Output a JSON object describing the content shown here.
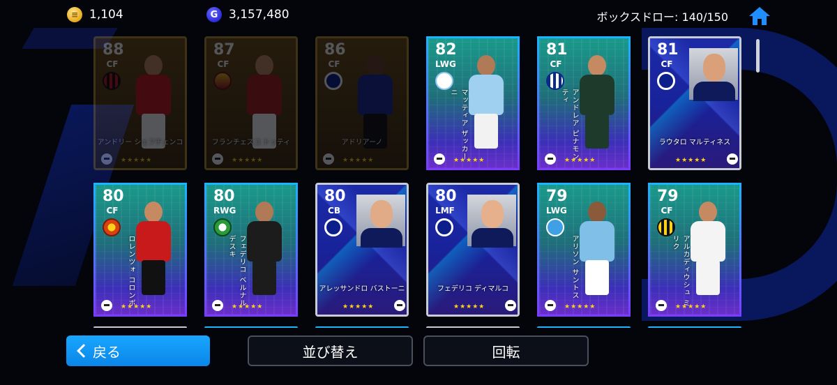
{
  "topbar": {
    "coin_value": "1,104",
    "gp_symbol": "G",
    "gp_value": "3,157,480",
    "box_draw": "ボックスドロー: 140/150"
  },
  "colors": {
    "accent": "#0a86e8",
    "star": "#ffd21a"
  },
  "cards": [
    {
      "rating": "88",
      "position": "CF",
      "name": "アンドリー シェフチェンコ",
      "name_style": "horizontal",
      "faded": true
    },
    {
      "rating": "87",
      "position": "CF",
      "name": "フランチェスコ トッティ",
      "name_style": "horizontal",
      "faded": true
    },
    {
      "rating": "86",
      "position": "CF",
      "name": "アドリアーノ",
      "name_style": "horizontal",
      "faded": true
    },
    {
      "rating": "82",
      "position": "LWG",
      "name": "マッティア ザッカーニ",
      "name_style": "vertical",
      "faded": false
    },
    {
      "rating": "81",
      "position": "CF",
      "name": "アンドレア ピナモンティ",
      "name_style": "vertical",
      "faded": false
    },
    {
      "rating": "81",
      "position": "CF",
      "name": "ラウタロ マルティネス",
      "name_style": "horizontal",
      "faded": false
    },
    {
      "rating": "80",
      "position": "CF",
      "name": "ロレンツォ コロンボ",
      "name_style": "vertical",
      "faded": false
    },
    {
      "rating": "80",
      "position": "RWG",
      "name": "フェデリコ ベルナルデスキ",
      "name_style": "vertical",
      "faded": false
    },
    {
      "rating": "80",
      "position": "CB",
      "name": "アレッサンドロ バストーニ",
      "name_style": "horizontal",
      "faded": false
    },
    {
      "rating": "80",
      "position": "LMF",
      "name": "フェデリコ ディマルコ",
      "name_style": "horizontal",
      "faded": false
    },
    {
      "rating": "79",
      "position": "LWG",
      "name": "アリソン サントス",
      "name_style": "vertical",
      "faded": false
    },
    {
      "rating": "79",
      "position": "CF",
      "name": "アルカディウシュ ミリク",
      "name_style": "vertical",
      "faded": false
    }
  ],
  "stars": "★★★★★",
  "buttons": {
    "back": "戻る",
    "sort": "並び替え",
    "rotate": "回転"
  },
  "icons": {
    "coin": "coin-icon",
    "gp": "gp-icon",
    "home": "home-icon",
    "back": "chevron-left-icon"
  }
}
